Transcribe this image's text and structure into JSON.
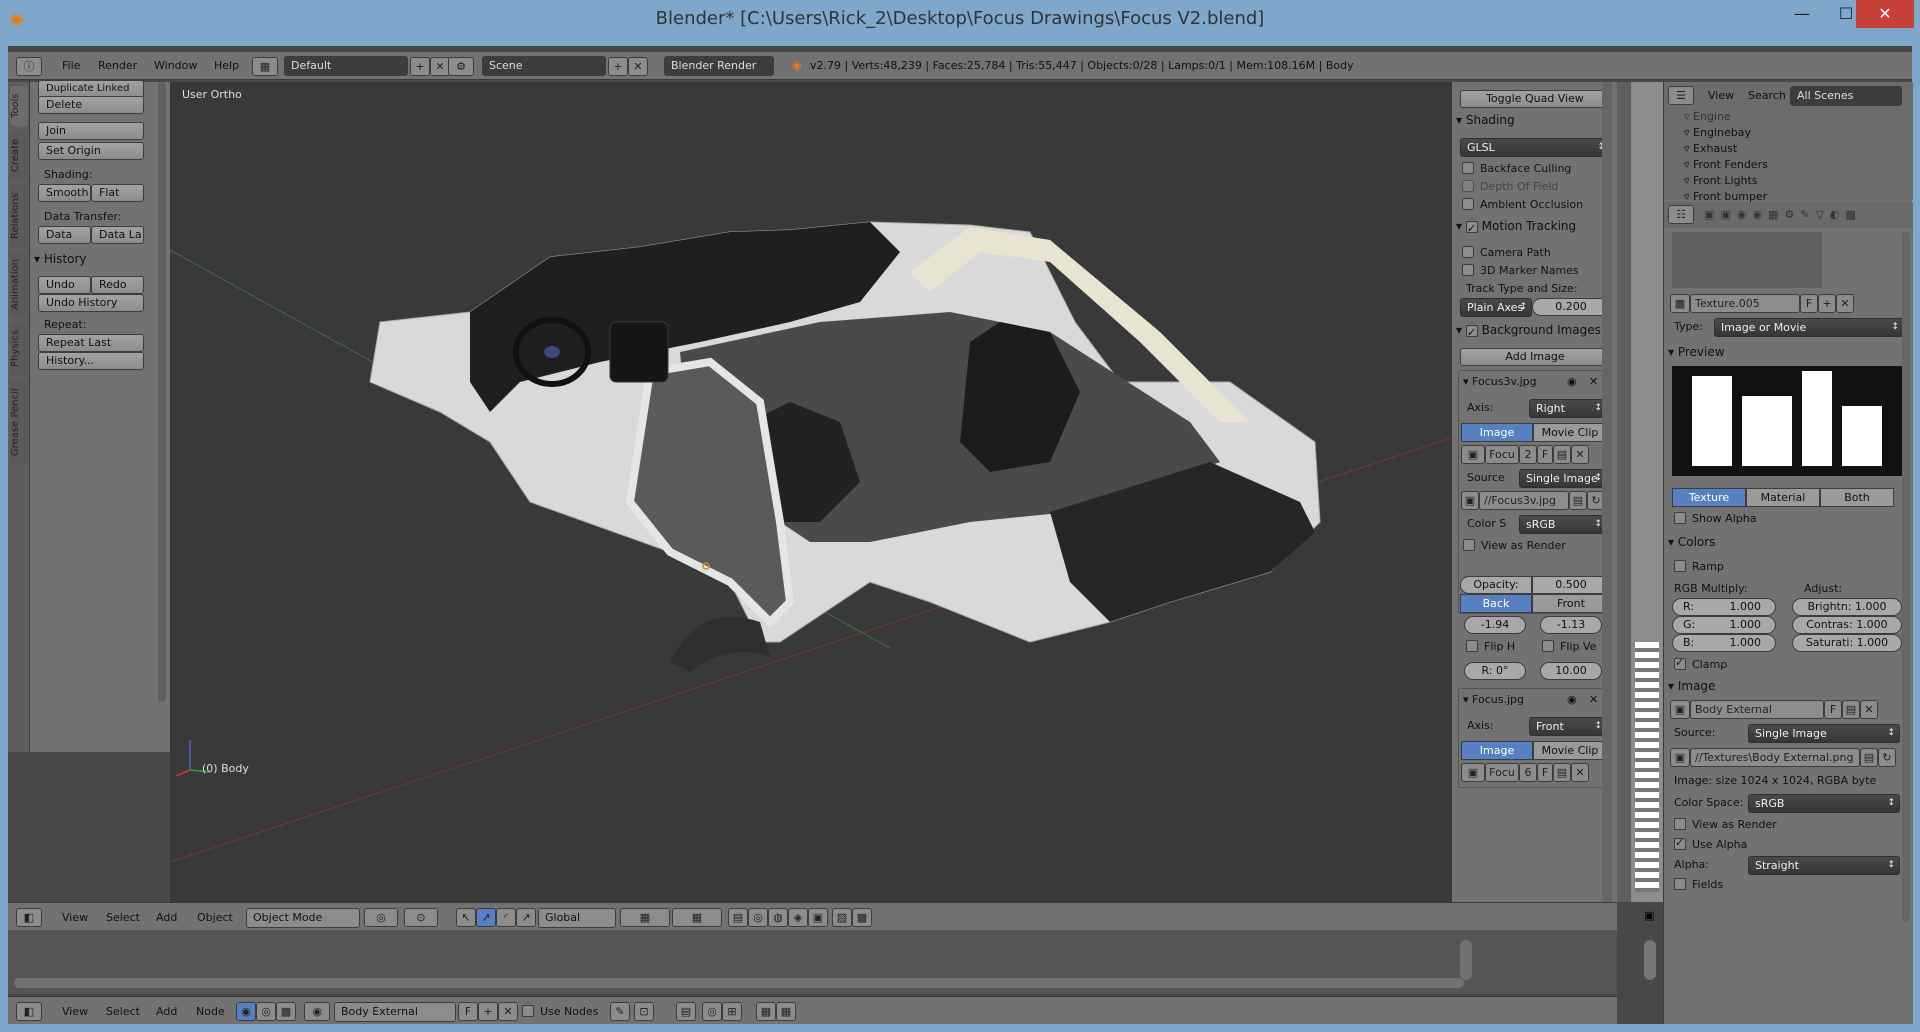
{
  "window": {
    "title": "Blender* [C:\\Users\\Rick_2\\Desktop\\Focus Drawings\\Focus V2.blend]",
    "minimize": "—",
    "maximize": "☐",
    "close": "✕"
  },
  "topbar": {
    "menus": [
      "File",
      "Render",
      "Window",
      "Help"
    ],
    "layout": "Default",
    "scene": "Scene",
    "engine": "Blender Render",
    "stats": "v2.79 | Verts:48,239 | Faces:25,784 | Tris:55,447 | Objects:0/28 | Lamps:0/1 | Mem:108.16M | Body"
  },
  "tool_tabs": [
    "Tools",
    "Create",
    "Relations",
    "Animation",
    "Physics",
    "Grease Pencil"
  ],
  "toolshelf": {
    "duplicate_linked": "Duplicate Linked",
    "delete": "Delete",
    "join": "Join",
    "set_origin": "Set Origin",
    "shading_label": "Shading:",
    "smooth": "Smooth",
    "flat": "Flat",
    "data_transfer_label": "Data Transfer:",
    "data": "Data",
    "data_la": "Data La",
    "history_header": "History",
    "undo": "Undo",
    "redo": "Redo",
    "undo_history": "Undo History",
    "repeat_label": "Repeat:",
    "repeat_last": "Repeat Last",
    "history_btn": "History..."
  },
  "viewport": {
    "view_label": "User Ortho",
    "object_label": "(0) Body"
  },
  "npanel": {
    "toggle_quad": "Toggle Quad View",
    "shading_header": "Shading",
    "shading_mode": "GLSL",
    "backface_culling": "Backface Culling",
    "depth_of_field": "Depth Of Field",
    "ambient_occlusion": "Ambient Occlusion",
    "motion_tracking": "Motion Tracking",
    "camera_path": "Camera Path",
    "marker_names": "3D Marker Names",
    "track_type_label": "Track Type and Size:",
    "plain_axes": "Plain Axes",
    "track_size": "0.200",
    "bg_images_header": "Background Images",
    "add_image": "Add Image",
    "img1": {
      "name": "Focus3v.jpg",
      "axis_label": "Axis:",
      "axis": "Right",
      "image": "Image",
      "movie_clip": "Movie Clip",
      "datablock": "Focu",
      "users": "2",
      "fake": "F",
      "source_label": "Source",
      "source": "Single Image",
      "path": "//Focus3v.jpg",
      "color_label": "Color S",
      "color_space": "sRGB",
      "view_as_render": "View as Render",
      "opacity": "Opacity:",
      "opacity_val": "0.500",
      "back": "Back",
      "front": "Front",
      "x": "-1.94",
      "y": "-1.13",
      "flip_h": "Flip H",
      "flip_v": "Flip Ve",
      "rot": "R: 0°",
      "size": "10.00"
    },
    "img2": {
      "name": "Focus.jpg",
      "axis_label": "Axis:",
      "axis": "Front",
      "image": "Image",
      "movie_clip": "Movie Clip",
      "datablock": "Focu",
      "users": "6",
      "fake": "F"
    }
  },
  "outliner": {
    "view": "View",
    "search": "Search",
    "scenes": "All Scenes",
    "items": [
      "Engine",
      "Enginebay",
      "Exhaust",
      "Front Fenders",
      "Front Lights",
      "Front bumper"
    ]
  },
  "properties": {
    "texture_name": "Texture.005",
    "fake": "F",
    "type_label": "Type:",
    "type": "Image or Movie",
    "preview_header": "Preview",
    "preview_tabs": [
      "Texture",
      "Material",
      "Both"
    ],
    "show_alpha": "Show Alpha",
    "colors_header": "Colors",
    "ramp": "Ramp",
    "rgb_label": "RGB Multiply:",
    "adjust_label": "Adjust:",
    "r": "R:",
    "g": "G:",
    "b": "B:",
    "r_val": "1.000",
    "g_val": "1.000",
    "b_val": "1.000",
    "brightness": "Brightn: 1.000",
    "contrast": "Contras: 1.000",
    "saturation": "Saturati: 1.000",
    "clamp": "Clamp",
    "image_header": "Image",
    "image_name": "Body External",
    "source_label": "Source:",
    "source": "Single Image",
    "path": "//Textures\\Body External.png",
    "image_info": "Image: size 1024 x 1024, RGBA byte",
    "color_space_label": "Color Space:",
    "color_space": "sRGB",
    "view_as_render": "View as Render",
    "use_alpha": "Use Alpha",
    "alpha_label": "Alpha:",
    "alpha": "Straight",
    "fields": "Fields"
  },
  "vpheader": {
    "view": "View",
    "select": "Select",
    "add": "Add",
    "object": "Object",
    "mode": "Object Mode",
    "orientation": "Global"
  },
  "nodeheader": {
    "view": "View",
    "select": "Select",
    "add": "Add",
    "node": "Node",
    "material": "Body External",
    "fake": "F",
    "use_nodes": "Use Nodes"
  },
  "colors": {
    "accent": "#5680c2",
    "titlebar": "#7fa7cc",
    "panel": "#727272",
    "viewport": "#393939"
  }
}
